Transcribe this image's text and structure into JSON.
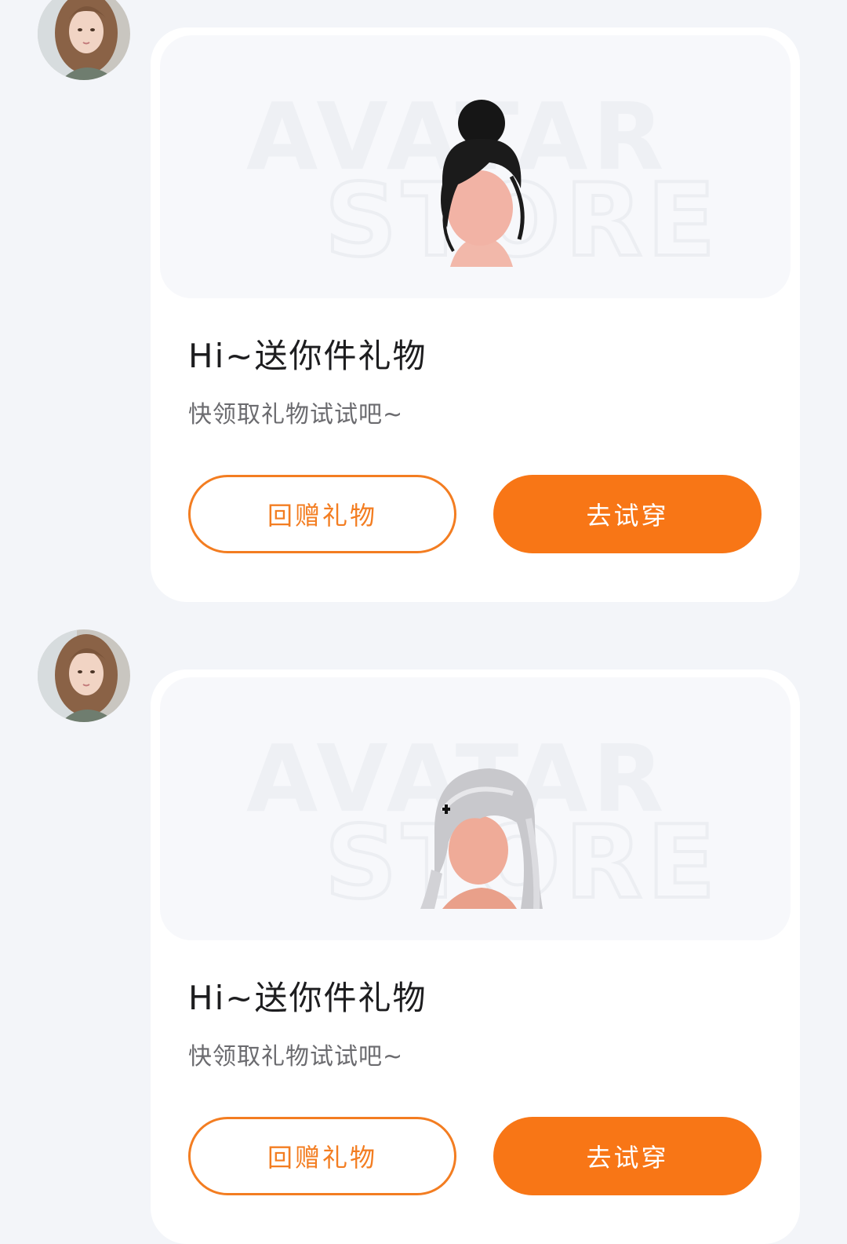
{
  "colors": {
    "background": "#f3f5f9",
    "card": "#ffffff",
    "accent": "#f87616",
    "accent_outline": "#f37d21",
    "title_text": "#1d1d1f",
    "sub_text": "#6b6b6f"
  },
  "messages": [
    {
      "sender_avatar_icon": "female-avatar-photo",
      "card": {
        "watermark_line1": "AVATAR",
        "watermark_line2": "STORE",
        "item_icon": "black-bun-hairstyle",
        "title": "Hi~送你件礼物",
        "subtitle": "快领取礼物试试吧~",
        "return_gift_label": "回赠礼物",
        "try_on_label": "去试穿"
      }
    },
    {
      "sender_avatar_icon": "female-avatar-photo",
      "card": {
        "watermark_line1": "AVATAR",
        "watermark_line2": "STORE",
        "item_icon": "silver-long-hairstyle",
        "title": "Hi~送你件礼物",
        "subtitle": "快领取礼物试试吧~",
        "return_gift_label": "回赠礼物",
        "try_on_label": "去试穿"
      }
    }
  ]
}
